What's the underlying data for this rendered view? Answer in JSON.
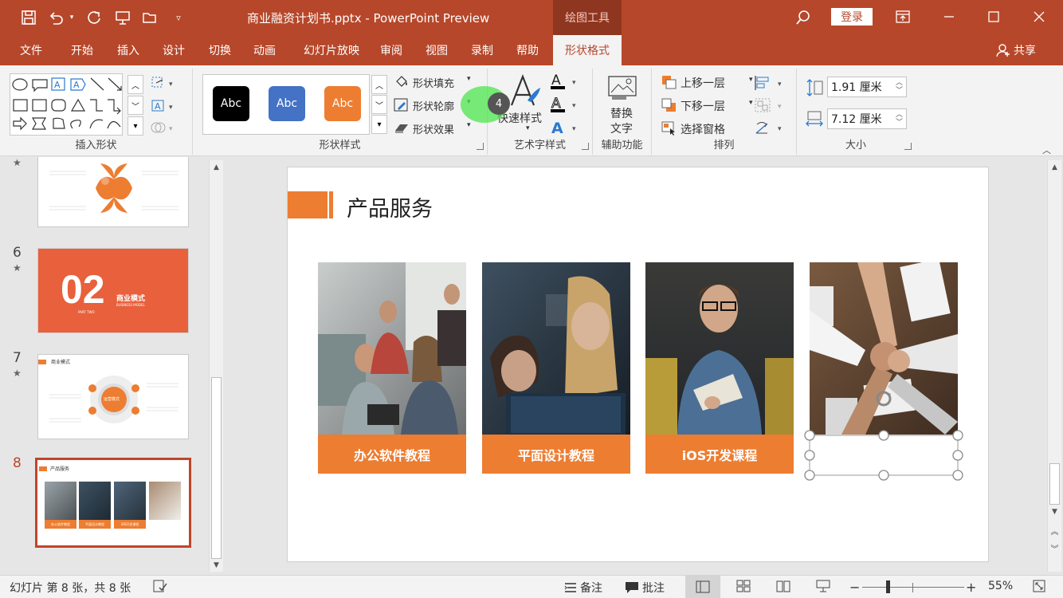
{
  "window": {
    "title": "商业融资计划书.pptx - PowerPoint Preview",
    "contextual_tab_title": "绘图工具",
    "login_label": "登录"
  },
  "tabs": [
    {
      "label": "文件"
    },
    {
      "label": "开始"
    },
    {
      "label": "插入"
    },
    {
      "label": "设计"
    },
    {
      "label": "切换"
    },
    {
      "label": "动画"
    },
    {
      "label": "幻灯片放映"
    },
    {
      "label": "审阅"
    },
    {
      "label": "视图"
    },
    {
      "label": "录制"
    },
    {
      "label": "帮助"
    },
    {
      "label": "形状格式"
    }
  ],
  "share_label": "共享",
  "ribbon": {
    "insert_shapes": {
      "label": "插入形状"
    },
    "shape_styles": {
      "label": "形状样式",
      "gallery": [
        {
          "text": "Abc",
          "color": "#000000"
        },
        {
          "text": "Abc",
          "color": "#4472c4"
        },
        {
          "text": "Abc",
          "color": "#ed7d31"
        }
      ],
      "fill_label": "形状填充",
      "outline_label": "形状轮廓",
      "effect_label": "形状效果"
    },
    "art_styles": {
      "label": "艺术字样式",
      "quick_styles_label": "快速样式",
      "badge": "4"
    },
    "accessibility": {
      "label": "辅助功能",
      "alt_text_line1": "替换",
      "alt_text_line2": "文字"
    },
    "arrange": {
      "label": "排列",
      "bring_forward": "上移一层",
      "send_backward": "下移一层",
      "selection_pane": "选择窗格"
    },
    "size": {
      "label": "大小",
      "height": "1.91 厘米",
      "width": "7.12 厘米"
    }
  },
  "slides_panel": {
    "thumbs": [
      {
        "number": "6",
        "big_text": "02",
        "title": "商业模式",
        "subtitle": "BUSINESS MODEL",
        "part": "PART TWO"
      },
      {
        "number": "7",
        "title": "商业模式",
        "center_text": "运营模式"
      },
      {
        "number": "8",
        "title": "产品服务",
        "labels": [
          "办公软件教程",
          "平面设计教程",
          "iOS开发课程"
        ]
      }
    ]
  },
  "slide": {
    "title": "产品服务",
    "cards": [
      {
        "label": "办公软件教程"
      },
      {
        "label": "平面设计教程"
      },
      {
        "label": "iOS开发课程"
      },
      {
        "label": ""
      }
    ]
  },
  "status": {
    "slide_info": "幻灯片 第 8 张，共 8 张",
    "notes_label": "备注",
    "comments_label": "批注",
    "zoom": "55%"
  },
  "colors": {
    "brand": "#b7472a",
    "accent": "#ed7d31"
  }
}
